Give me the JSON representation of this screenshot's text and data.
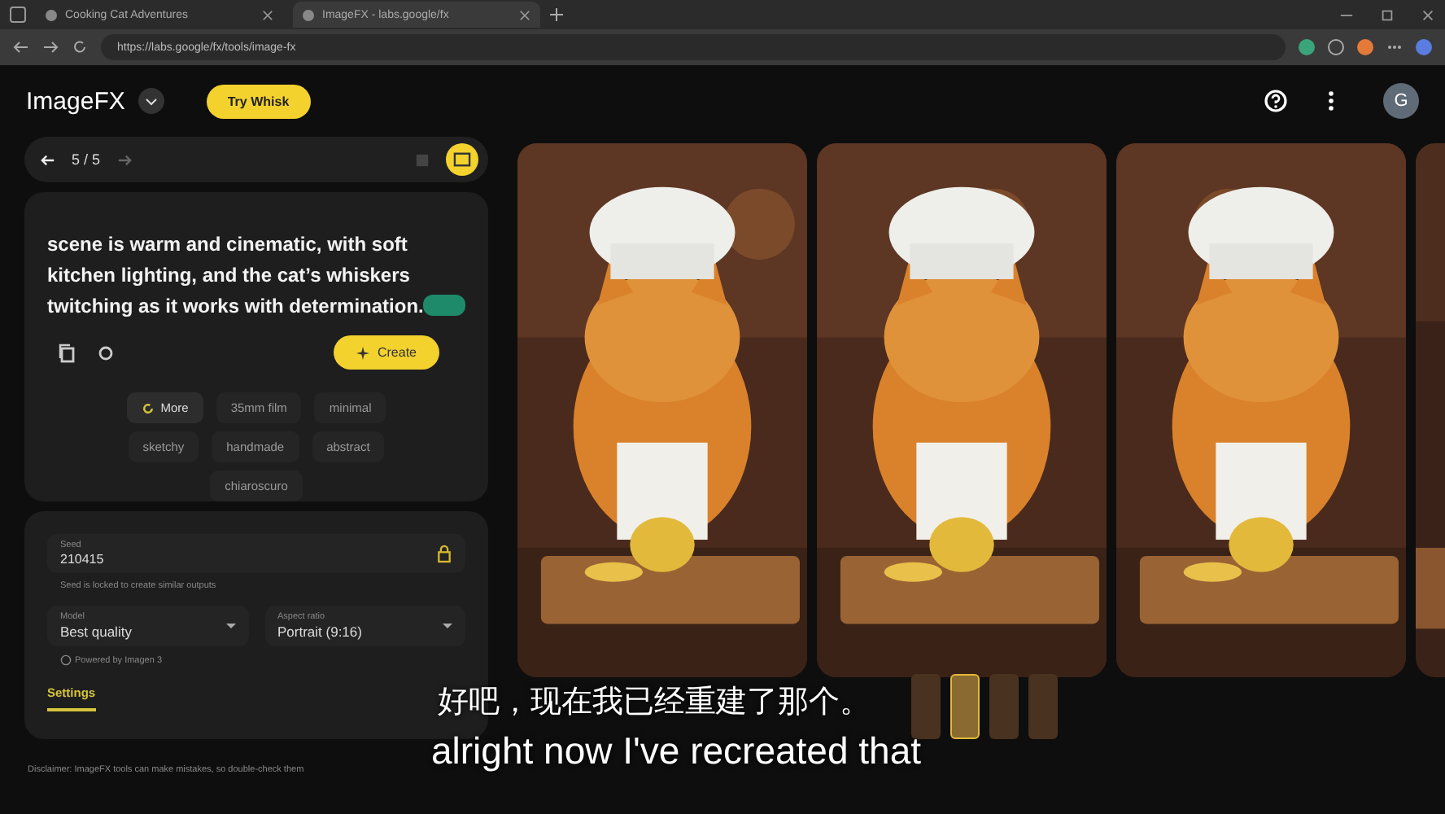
{
  "browser": {
    "tabs": [
      {
        "title": "Cooking Cat Adventures",
        "selected": false
      },
      {
        "title": "ImageFX - labs.google/fx",
        "selected": true
      }
    ],
    "url": "https://labs.google/fx/tools/image-fx"
  },
  "header": {
    "logo": "ImageFX",
    "promo_button": "Try Whisk",
    "avatar": "G"
  },
  "history": {
    "counter": "5 / 5"
  },
  "prompt": {
    "text": "scene is warm and cinematic, with soft kitchen lighting, and the cat’s whiskers twitching as it works with determination.",
    "create_button": "Create"
  },
  "chips": [
    {
      "label": "More",
      "kind": "more"
    },
    {
      "label": "35mm film",
      "kind": "style"
    },
    {
      "label": "minimal",
      "kind": "style"
    },
    {
      "label": "sketchy",
      "kind": "style"
    },
    {
      "label": "handmade",
      "kind": "style"
    },
    {
      "label": "abstract",
      "kind": "style"
    },
    {
      "label": "chiaroscuro",
      "kind": "style"
    }
  ],
  "settings": {
    "seed_label": "Seed",
    "seed": "210415",
    "seed_note": "Seed is locked to create similar outputs",
    "model_label": "Model",
    "model": "Best quality",
    "aspect_label": "Aspect ratio",
    "aspect": "Portrait (9:16)",
    "powered_by": "Powered by Imagen 3"
  },
  "panel_tabs": [
    {
      "label": "Settings",
      "selected": true
    }
  ],
  "disclaimer": "Disclaimer: ImageFX tools can make mistakes, so double-check them",
  "images": [
    {
      "kind": "picture"
    },
    {
      "kind": "picture"
    },
    {
      "kind": "picture"
    }
  ],
  "thumbnails": [
    {
      "selected": false
    },
    {
      "selected": true
    },
    {
      "selected": false
    },
    {
      "selected": false
    }
  ],
  "subtitles": [
    "好吧，现在我已经重建了那个。",
    "alright now I've recreated that"
  ]
}
